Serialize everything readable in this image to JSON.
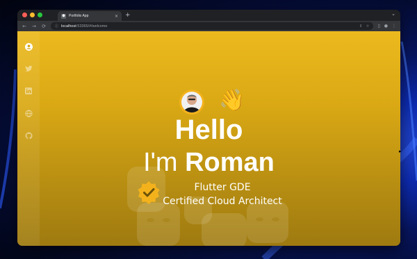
{
  "browser": {
    "tab_title": "Portfolio App",
    "tab_close": "×",
    "new_tab": "+",
    "tab_menu": "⌄",
    "url_host": "localhost",
    "url_rest": ":53365/#/welcome"
  },
  "sidebar": {
    "items": [
      {
        "icon": "person-icon"
      },
      {
        "icon": "twitter-icon"
      },
      {
        "icon": "linkedin-icon"
      },
      {
        "icon": "globe-icon"
      },
      {
        "icon": "github-icon"
      }
    ]
  },
  "hero": {
    "greeting": "Hello",
    "intro_prefix": "I'm ",
    "name": "Roman",
    "wave_emoji": "👋",
    "title_1": "Flutter GDE",
    "title_2": "Certified Cloud Architect"
  },
  "colors": {
    "page_top": "#ecba1e",
    "page_bottom": "#9e7a10",
    "badge": "#f3b21c"
  }
}
